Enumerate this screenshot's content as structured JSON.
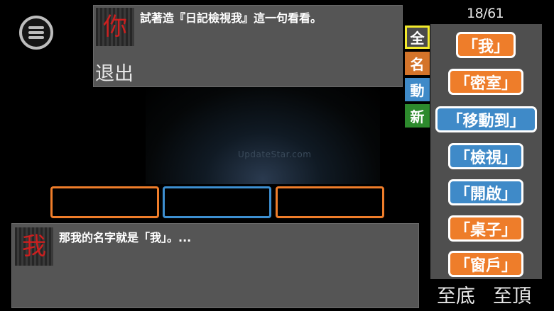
{
  "top_dialog": {
    "speaker_char": "你",
    "text": "試著造『日記檢視我』這一句看看。",
    "exit_label": "退出"
  },
  "watermark": "UpdateStar.com",
  "bottom_dialog": {
    "speaker_char": "我",
    "text": "那我的名字就是「我」。..."
  },
  "categories": [
    {
      "label": "全",
      "color": "#4a4a4a",
      "selected": true
    },
    {
      "label": "名",
      "color": "#d4742a"
    },
    {
      "label": "動",
      "color": "#3f8ac8"
    },
    {
      "label": "新",
      "color": "#2d8a2d"
    }
  ],
  "page_counter": "18/61",
  "words": [
    {
      "label": "「我」",
      "type": "noun",
      "color": "#ee7d2a"
    },
    {
      "label": "「密室」",
      "type": "noun",
      "color": "#ee7d2a"
    },
    {
      "label": "「移動到」",
      "type": "verb",
      "color": "#3f8ac8"
    },
    {
      "label": "「檢視」",
      "type": "verb",
      "color": "#3f8ac8"
    },
    {
      "label": "「開啟」",
      "type": "verb",
      "color": "#3f8ac8"
    },
    {
      "label": "「桌子」",
      "type": "noun",
      "color": "#ee7d2a"
    },
    {
      "label": "「窗戶」",
      "type": "noun",
      "color": "#ee7d2a"
    }
  ],
  "nav": {
    "to_bottom": "至底",
    "to_top": "至頂"
  },
  "icons": {
    "menu": "hamburger-menu-icon"
  }
}
